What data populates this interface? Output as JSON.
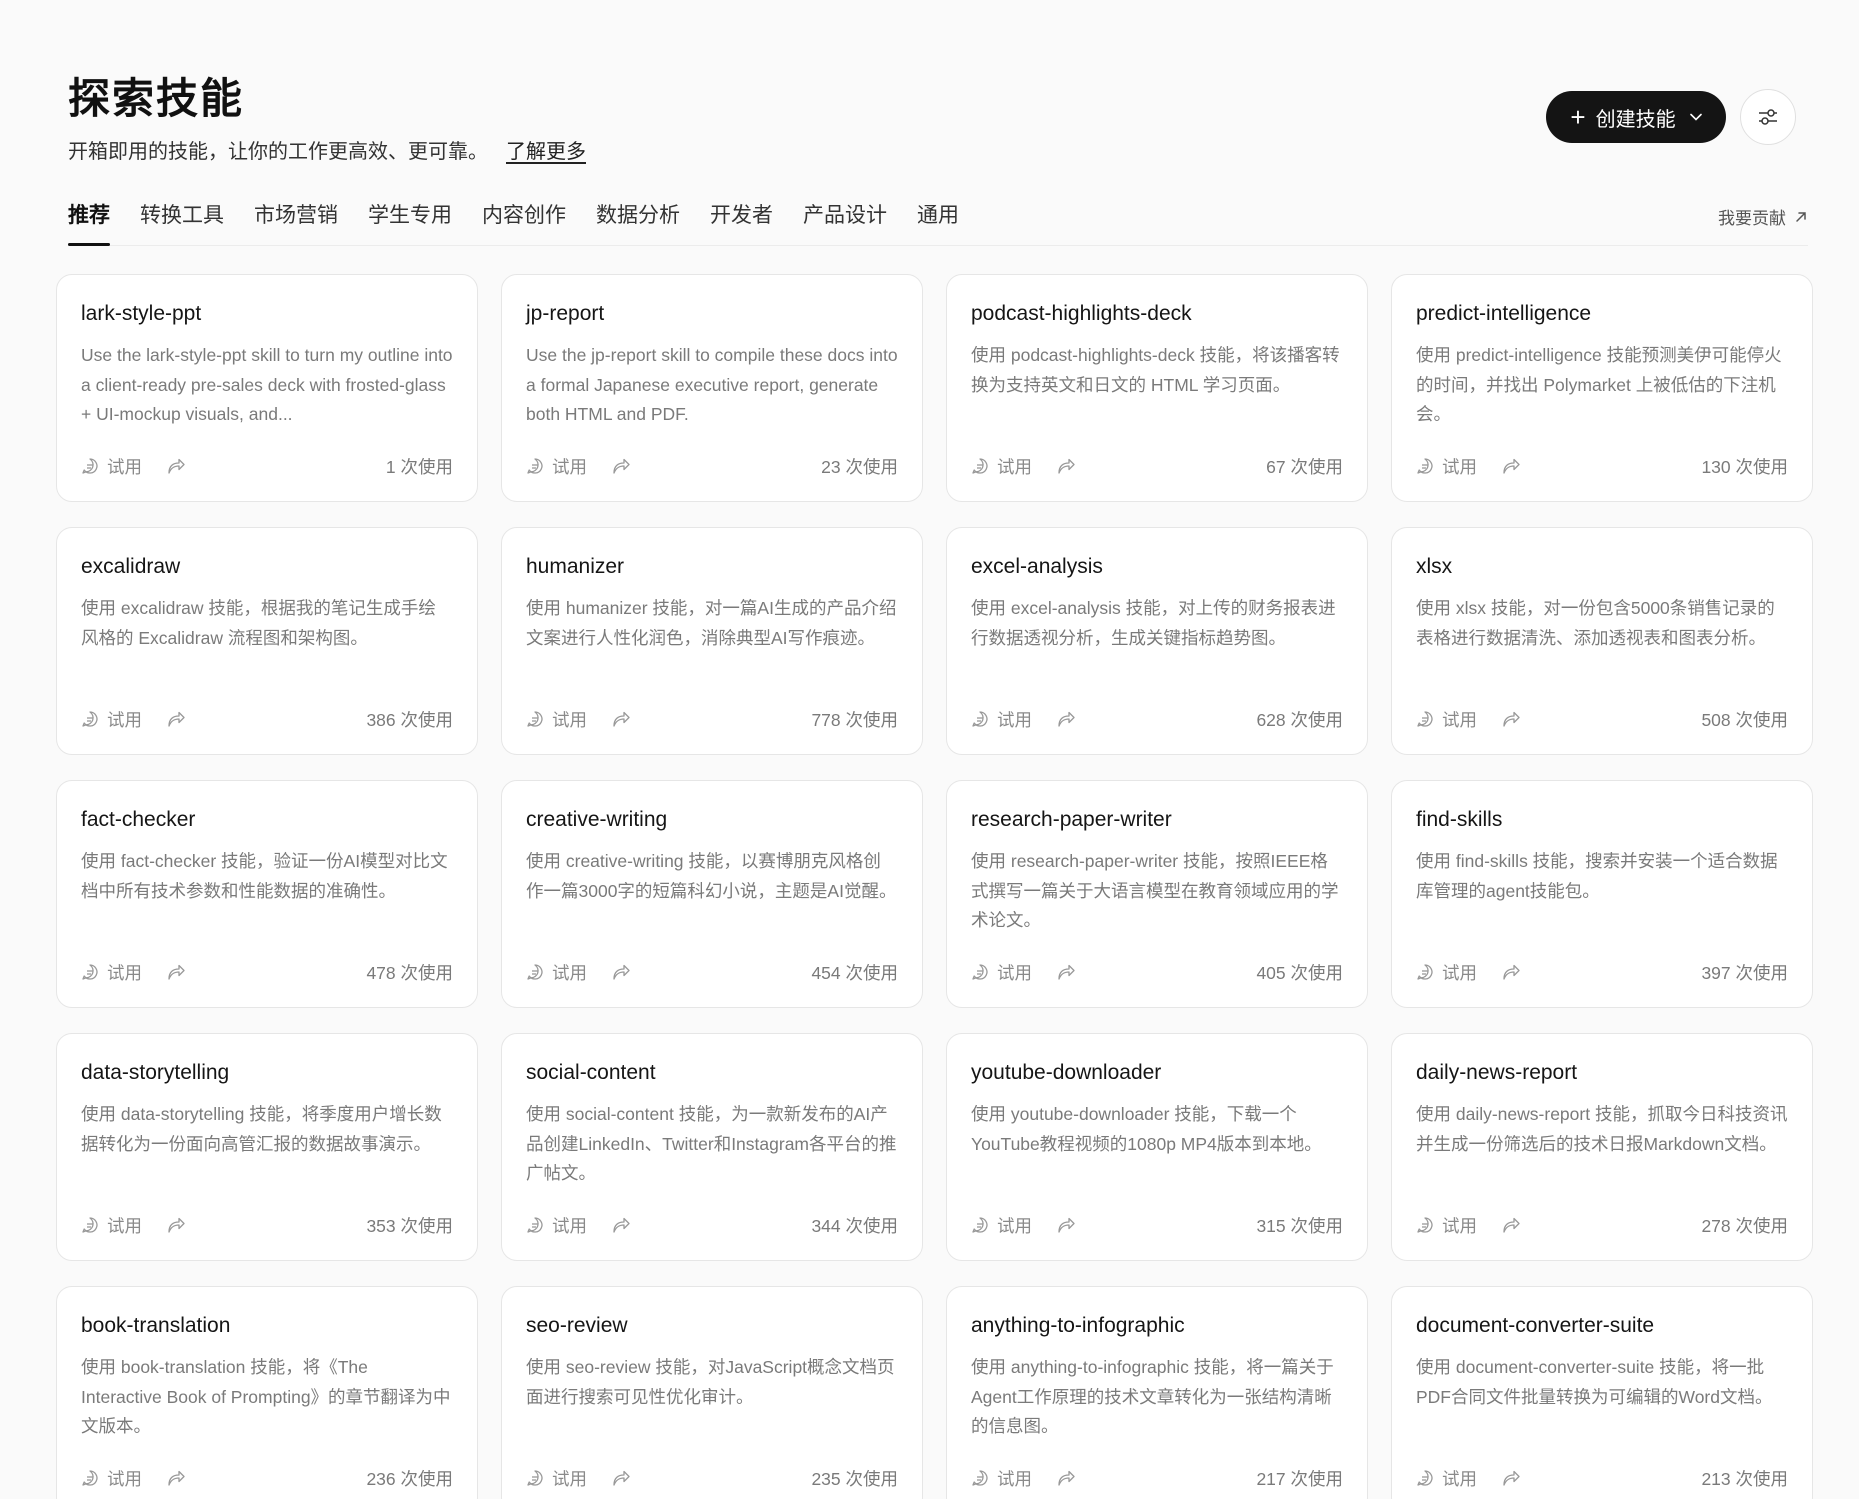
{
  "header": {
    "title": "探索技能",
    "subtitle": "开箱即用的技能，让你的工作更高效、更可靠。",
    "learn_more": "了解更多",
    "create_label": "创建技能",
    "filter_icon": "sliders-icon"
  },
  "tabs": [
    {
      "label": "推荐",
      "active": true
    },
    {
      "label": "转换工具"
    },
    {
      "label": "市场营销"
    },
    {
      "label": "学生专用"
    },
    {
      "label": "内容创作"
    },
    {
      "label": "数据分析"
    },
    {
      "label": "开发者"
    },
    {
      "label": "产品设计"
    },
    {
      "label": "通用"
    }
  ],
  "contribute_label": "我要贡献",
  "card_try_label": "试用",
  "cards": [
    {
      "title": "lark-style-ppt",
      "desc": "Use the lark-style-ppt skill to turn my outline into a client-ready pre-sales deck with frosted-glass + UI-mockup visuals, and...",
      "uses": "1 次使用"
    },
    {
      "title": "jp-report",
      "desc": "Use the jp-report skill to compile these docs into a formal Japanese executive report, generate both HTML and PDF.",
      "uses": "23 次使用"
    },
    {
      "title": "podcast-highlights-deck",
      "desc": "使用 podcast-highlights-deck 技能，将该播客转换为支持英文和日文的 HTML 学习页面。",
      "uses": "67 次使用"
    },
    {
      "title": "predict-intelligence",
      "desc": "使用 predict-intelligence 技能预测美伊可能停火的时间，并找出 Polymarket 上被低估的下注机会。",
      "uses": "130 次使用"
    },
    {
      "title": "excalidraw",
      "desc": "使用 excalidraw 技能，根据我的笔记生成手绘风格的 Excalidraw 流程图和架构图。",
      "uses": "386 次使用"
    },
    {
      "title": "humanizer",
      "desc": "使用 humanizer 技能，对一篇AI生成的产品介绍文案进行人性化润色，消除典型AI写作痕迹。",
      "uses": "778 次使用"
    },
    {
      "title": "excel-analysis",
      "desc": "使用 excel-analysis 技能，对上传的财务报表进行数据透视分析，生成关键指标趋势图。",
      "uses": "628 次使用"
    },
    {
      "title": "xlsx",
      "desc": "使用 xlsx 技能，对一份包含5000条销售记录的表格进行数据清洗、添加透视表和图表分析。",
      "uses": "508 次使用"
    },
    {
      "title": "fact-checker",
      "desc": "使用 fact-checker 技能，验证一份AI模型对比文档中所有技术参数和性能数据的准确性。",
      "uses": "478 次使用"
    },
    {
      "title": "creative-writing",
      "desc": "使用 creative-writing 技能，以赛博朋克风格创作一篇3000字的短篇科幻小说，主题是AI觉醒。",
      "uses": "454 次使用"
    },
    {
      "title": "research-paper-writer",
      "desc": "使用 research-paper-writer 技能，按照IEEE格式撰写一篇关于大语言模型在教育领域应用的学术论文。",
      "uses": "405 次使用"
    },
    {
      "title": "find-skills",
      "desc": "使用 find-skills 技能，搜索并安装一个适合数据库管理的agent技能包。",
      "uses": "397 次使用"
    },
    {
      "title": "data-storytelling",
      "desc": "使用 data-storytelling 技能，将季度用户增长数据转化为一份面向高管汇报的数据故事演示。",
      "uses": "353 次使用"
    },
    {
      "title": "social-content",
      "desc": "使用 social-content 技能，为一款新发布的AI产品创建LinkedIn、Twitter和Instagram各平台的推广帖文。",
      "uses": "344 次使用"
    },
    {
      "title": "youtube-downloader",
      "desc": "使用 youtube-downloader 技能，下载一个YouTube教程视频的1080p MP4版本到本地。",
      "uses": "315 次使用"
    },
    {
      "title": "daily-news-report",
      "desc": "使用 daily-news-report 技能，抓取今日科技资讯并生成一份筛选后的技术日报Markdown文档。",
      "uses": "278 次使用"
    },
    {
      "title": "book-translation",
      "desc": "使用 book-translation 技能，将《The Interactive Book of Prompting》的章节翻译为中文版本。",
      "uses": "236 次使用"
    },
    {
      "title": "seo-review",
      "desc": "使用 seo-review 技能，对JavaScript概念文档页面进行搜索可见性优化审计。",
      "uses": "235 次使用"
    },
    {
      "title": "anything-to-infographic",
      "desc": "使用 anything-to-infographic 技能，将一篇关于Agent工作原理的技术文章转化为一张结构清晰的信息图。",
      "uses": "217 次使用"
    },
    {
      "title": "document-converter-suite",
      "desc": "使用 document-converter-suite 技能，将一批PDF合同文件批量转换为可编辑的Word文档。",
      "uses": "213 次使用"
    }
  ]
}
